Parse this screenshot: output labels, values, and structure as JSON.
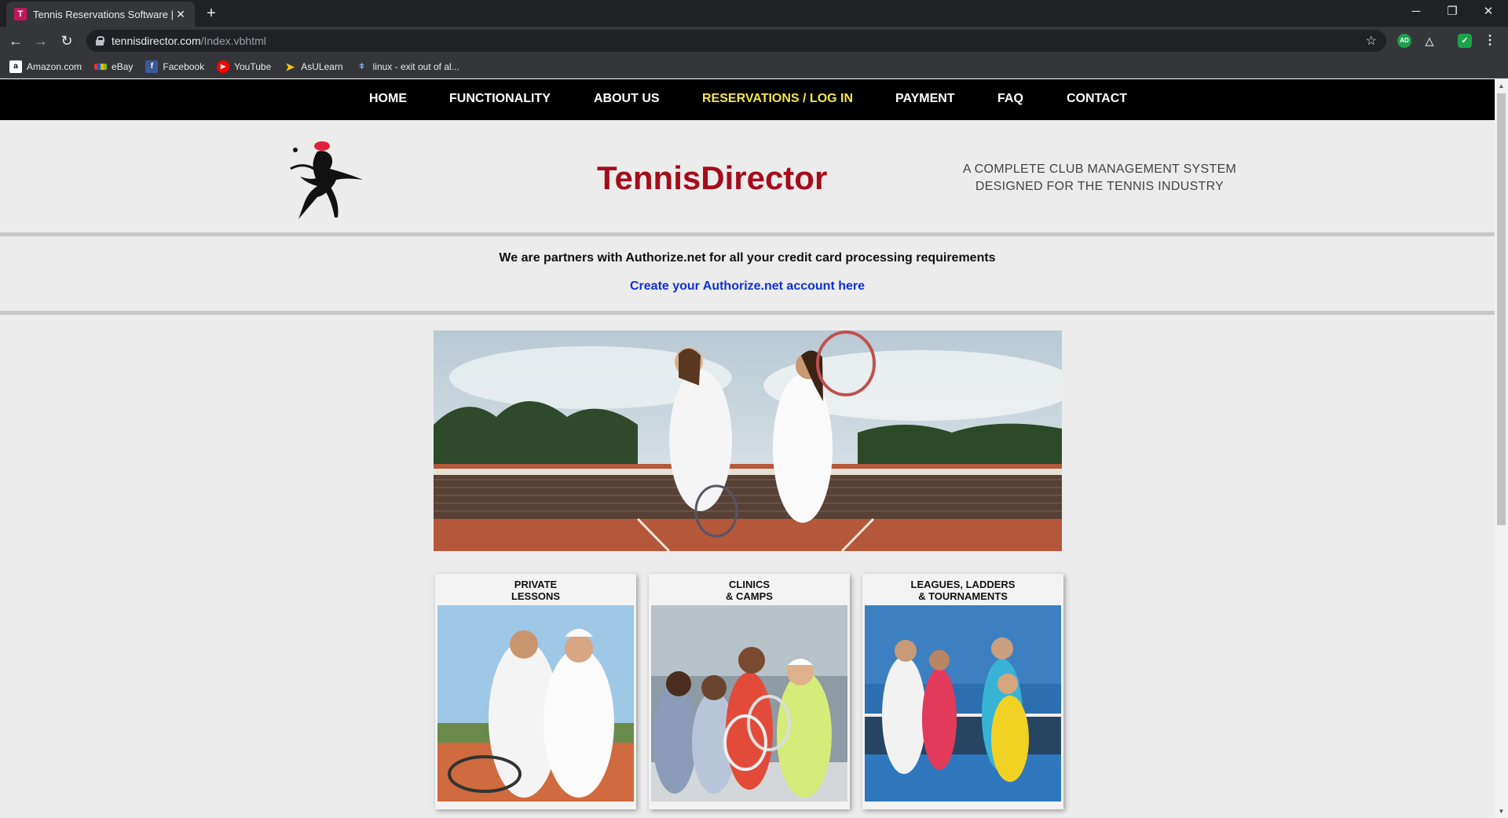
{
  "browser": {
    "tab_title": "Tennis Reservations Software | On",
    "url_host": "tennisdirector.com",
    "url_path": "/Index.vbhtml",
    "bookmarks": [
      {
        "label": "Amazon.com",
        "icon": "amazon-icon"
      },
      {
        "label": "eBay",
        "icon": "ebay-icon"
      },
      {
        "label": "Facebook",
        "icon": "facebook-icon"
      },
      {
        "label": "YouTube",
        "icon": "youtube-icon"
      },
      {
        "label": "AsULearn",
        "icon": "asulearn-icon"
      },
      {
        "label": "linux - exit out of al...",
        "icon": "linux-icon"
      }
    ]
  },
  "nav": {
    "items": [
      {
        "label": "HOME"
      },
      {
        "label": "FUNCTIONALITY"
      },
      {
        "label": "ABOUT US"
      },
      {
        "label": "RESERVATIONS / LOG IN"
      },
      {
        "label": "PAYMENT"
      },
      {
        "label": "FAQ"
      },
      {
        "label": "CONTACT"
      }
    ],
    "active_color": "#f5e54a"
  },
  "header": {
    "brand": "TennisDirector",
    "brand_color": "#a50c1a",
    "tagline_line1": "A COMPLETE CLUB MANAGEMENT SYSTEM",
    "tagline_line2": "DESIGNED FOR THE TENNIS INDUSTRY"
  },
  "partner": {
    "text": "We are partners with Authorize.net for all your credit card processing requirements",
    "link": "Create your Authorize.net account here",
    "link_color": "#1030d8"
  },
  "cards": [
    {
      "line1": "PRIVATE",
      "line2": "LESSONS"
    },
    {
      "line1": "CLINICS",
      "line2": "& CAMPS"
    },
    {
      "line1": "LEAGUES, LADDERS",
      "line2": "& TOURNAMENTS"
    }
  ]
}
